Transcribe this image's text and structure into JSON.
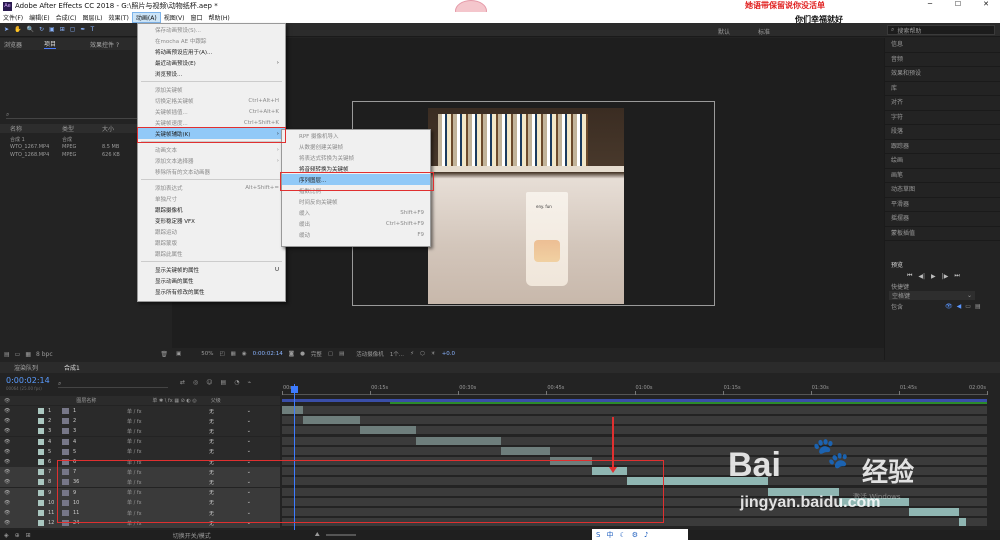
{
  "app": {
    "title": "Adobe After Effects CC 2018 - G:\\照片与视频\\动物纸杯.aep *"
  },
  "overlay": {
    "line1": "她语带保留说你没活单",
    "line2": "你们幸福就好"
  },
  "menubar": [
    "文件(F)",
    "编辑(E)",
    "合成(C)",
    "图层(L)",
    "效果(T)",
    "动画(A)",
    "视图(V)",
    "窗口",
    "帮助(H)"
  ],
  "workspaces": [
    "默认",
    "标准"
  ],
  "search": {
    "placeholder": "搜索帮助"
  },
  "project": {
    "tabs": [
      "项目",
      "效果控件 ?"
    ],
    "left_tab": "浏览器",
    "columns": [
      "名称",
      "类型",
      "大小"
    ],
    "items": [
      {
        "name": "合成 1",
        "type": "合成",
        "size": ""
      },
      {
        "name": "WTO_1267.MP4",
        "type": "MPEG",
        "size": "8.5 MB"
      },
      {
        "name": "WTO_1268.MP4",
        "type": "MPEG",
        "size": "626 KB"
      }
    ],
    "bpc": "8 bpc"
  },
  "anim_menu": [
    {
      "label": "保存动画预设(S)...",
      "shortcut": "",
      "dis": true
    },
    {
      "label": "在mocha AE 中跟踪",
      "shortcut": "",
      "dis": true
    },
    {
      "label": "将动画预设应用于(A)...",
      "shortcut": "",
      "dis": false
    },
    {
      "label": "最近动画预设(E)",
      "shortcut": "›",
      "dis": false
    },
    {
      "label": "浏览预设...",
      "shortcut": "",
      "dis": false
    },
    {
      "sep": true
    },
    {
      "label": "添加关键帧",
      "shortcut": "",
      "dis": true
    },
    {
      "label": "切换定格关键帧",
      "shortcut": "Ctrl+Alt+H",
      "dis": true
    },
    {
      "label": "关键帧插值...",
      "shortcut": "Ctrl+Alt+K",
      "dis": true
    },
    {
      "label": "关键帧速度...",
      "shortcut": "Ctrl+Shift+K",
      "dis": true
    },
    {
      "label": "关键帧辅助(K)",
      "shortcut": "›",
      "dis": false,
      "hl": true
    },
    {
      "sep": true
    },
    {
      "label": "动画文本",
      "shortcut": "›",
      "dis": true
    },
    {
      "label": "添加文本选择器",
      "shortcut": "›",
      "dis": true
    },
    {
      "label": "移除所有的文本动画器",
      "shortcut": "",
      "dis": true
    },
    {
      "sep": true
    },
    {
      "label": "添加表达式",
      "shortcut": "Alt+Shift+=",
      "dis": true
    },
    {
      "label": "单独尺寸",
      "shortcut": "",
      "dis": true
    },
    {
      "label": "跟踪摄像机",
      "shortcut": "",
      "dis": false
    },
    {
      "label": "变形稳定器 VFX",
      "shortcut": "",
      "dis": false
    },
    {
      "label": "跟踪运动",
      "shortcut": "",
      "dis": true
    },
    {
      "label": "跟踪蒙版",
      "shortcut": "",
      "dis": true
    },
    {
      "label": "跟踪此属性",
      "shortcut": "",
      "dis": true
    },
    {
      "sep": true
    },
    {
      "label": "显示关键帧的属性",
      "shortcut": "U",
      "dis": false
    },
    {
      "label": "显示动画的属性",
      "shortcut": "",
      "dis": false
    },
    {
      "label": "显示所有修改的属性",
      "shortcut": "",
      "dis": false
    }
  ],
  "sub_menu": [
    {
      "label": "RPF 摄像机导入",
      "shortcut": "",
      "dis": true
    },
    {
      "label": "从数据创建关键帧",
      "shortcut": "",
      "dis": true
    },
    {
      "label": "将表达式转换为关键帧",
      "shortcut": "",
      "dis": true
    },
    {
      "label": "将音频转换为关键帧",
      "shortcut": "",
      "dis": false
    },
    {
      "label": "序列图层...",
      "shortcut": "",
      "dis": false,
      "hl": true
    },
    {
      "label": "指数比例",
      "shortcut": "",
      "dis": true
    },
    {
      "label": "时间反向关键帧",
      "shortcut": "",
      "dis": true
    },
    {
      "label": "缓入",
      "shortcut": "Shift+F9",
      "dis": true
    },
    {
      "label": "缓出",
      "shortcut": "Ctrl+Shift+F9",
      "dis": true
    },
    {
      "label": "缓动",
      "shortcut": "F9",
      "dis": true
    }
  ],
  "viewer": {
    "cup_text": "eny. fun",
    "zoom": "50%",
    "time": "0:00:02:14",
    "quality": "完整",
    "camera": "活动摄像机",
    "views": "1个...",
    "exposure": "+0.0"
  },
  "right_panel": {
    "items": [
      "信息",
      "音频",
      "效果和预设",
      "库",
      "对齐",
      "字符",
      "段落",
      "跟踪器",
      "绘画",
      "画笔",
      "动态草图",
      "平滑器",
      "摇摆器",
      "蒙板插值"
    ],
    "preview": "预览",
    "shortcut_label": "快捷键",
    "shortcut_value": "空格键",
    "include": "包含"
  },
  "timeline": {
    "tabs": [
      "渲染队列",
      "合成1"
    ],
    "time": "0:00:02:14",
    "fps": "00064 (25.00 fps)",
    "col_name": "图层名称",
    "col_parent": "父级",
    "switch_label": "切换开关/模式",
    "ticks": [
      "00s",
      "00:15s",
      "00:30s",
      "00:45s",
      "01:00s",
      "01:15s",
      "01:30s",
      "01:45s",
      "02:00s"
    ],
    "layers": [
      {
        "num": "1",
        "name": "1",
        "parent": "无"
      },
      {
        "num": "2",
        "name": "2",
        "parent": "无"
      },
      {
        "num": "3",
        "name": "3",
        "parent": "无"
      },
      {
        "num": "4",
        "name": "4",
        "parent": "无"
      },
      {
        "num": "5",
        "name": "5",
        "parent": "无"
      },
      {
        "num": "6",
        "name": "6",
        "parent": "无"
      },
      {
        "num": "7",
        "name": "7",
        "parent": "无"
      },
      {
        "num": "8",
        "name": "36",
        "parent": "无"
      },
      {
        "num": "9",
        "name": "9",
        "parent": "无"
      },
      {
        "num": "10",
        "name": "10",
        "parent": "无"
      },
      {
        "num": "11",
        "name": "11",
        "parent": "无"
      },
      {
        "num": "12",
        "name": "24",
        "parent": "无"
      }
    ],
    "bars": [
      [
        0.0,
        0.03
      ],
      [
        0.03,
        0.11
      ],
      [
        0.11,
        0.19
      ],
      [
        0.19,
        0.31
      ],
      [
        0.31,
        0.38
      ],
      [
        0.38,
        0.44
      ],
      [
        0.44,
        0.49
      ],
      [
        0.49,
        0.69
      ],
      [
        0.69,
        0.79
      ],
      [
        0.79,
        0.89
      ],
      [
        0.89,
        0.96
      ],
      [
        0.96,
        0.97
      ]
    ]
  },
  "watermark": {
    "brand": "Bai",
    "brand2": "经验",
    "url": "jingyan.baidu.com",
    "windows": "激活 Windows"
  },
  "taskbar": [
    "中",
    "☾",
    "⚙",
    "♪"
  ]
}
